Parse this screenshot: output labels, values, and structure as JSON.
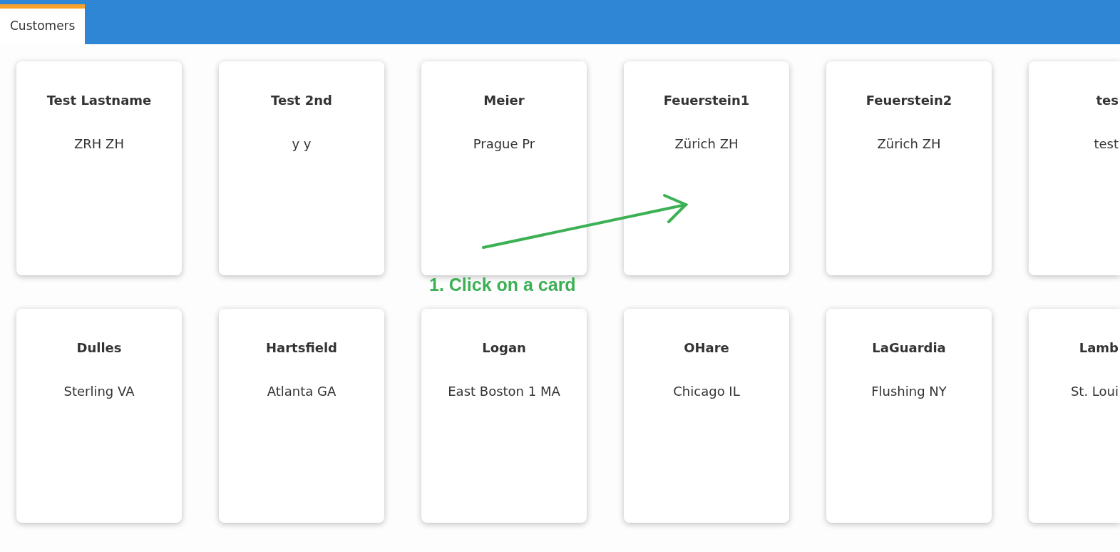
{
  "tabs": [
    {
      "label": "Customers",
      "selected": true
    }
  ],
  "card_rows": [
    [
      {
        "name": "Test Lastname",
        "address": "ZRH ZH"
      },
      {
        "name": "Test 2nd",
        "address": "y y"
      },
      {
        "name": "Meier",
        "address": "Prague Pr"
      },
      {
        "name": "Feuerstein1",
        "address": "Zürich ZH"
      },
      {
        "name": "Feuerstein2",
        "address": "Zürich ZH"
      },
      {
        "name": "tes",
        "address": "test"
      }
    ],
    [
      {
        "name": "Dulles",
        "address": "Sterling VA"
      },
      {
        "name": "Hartsfield",
        "address": "Atlanta GA"
      },
      {
        "name": "Logan",
        "address": "East Boston 1 MA"
      },
      {
        "name": "OHare",
        "address": "Chicago IL"
      },
      {
        "name": "LaGuardia",
        "address": "Flushing NY"
      },
      {
        "name": "Lamb",
        "address": "St. Loui"
      }
    ]
  ],
  "annotation": {
    "text": "1. Click on a card"
  }
}
